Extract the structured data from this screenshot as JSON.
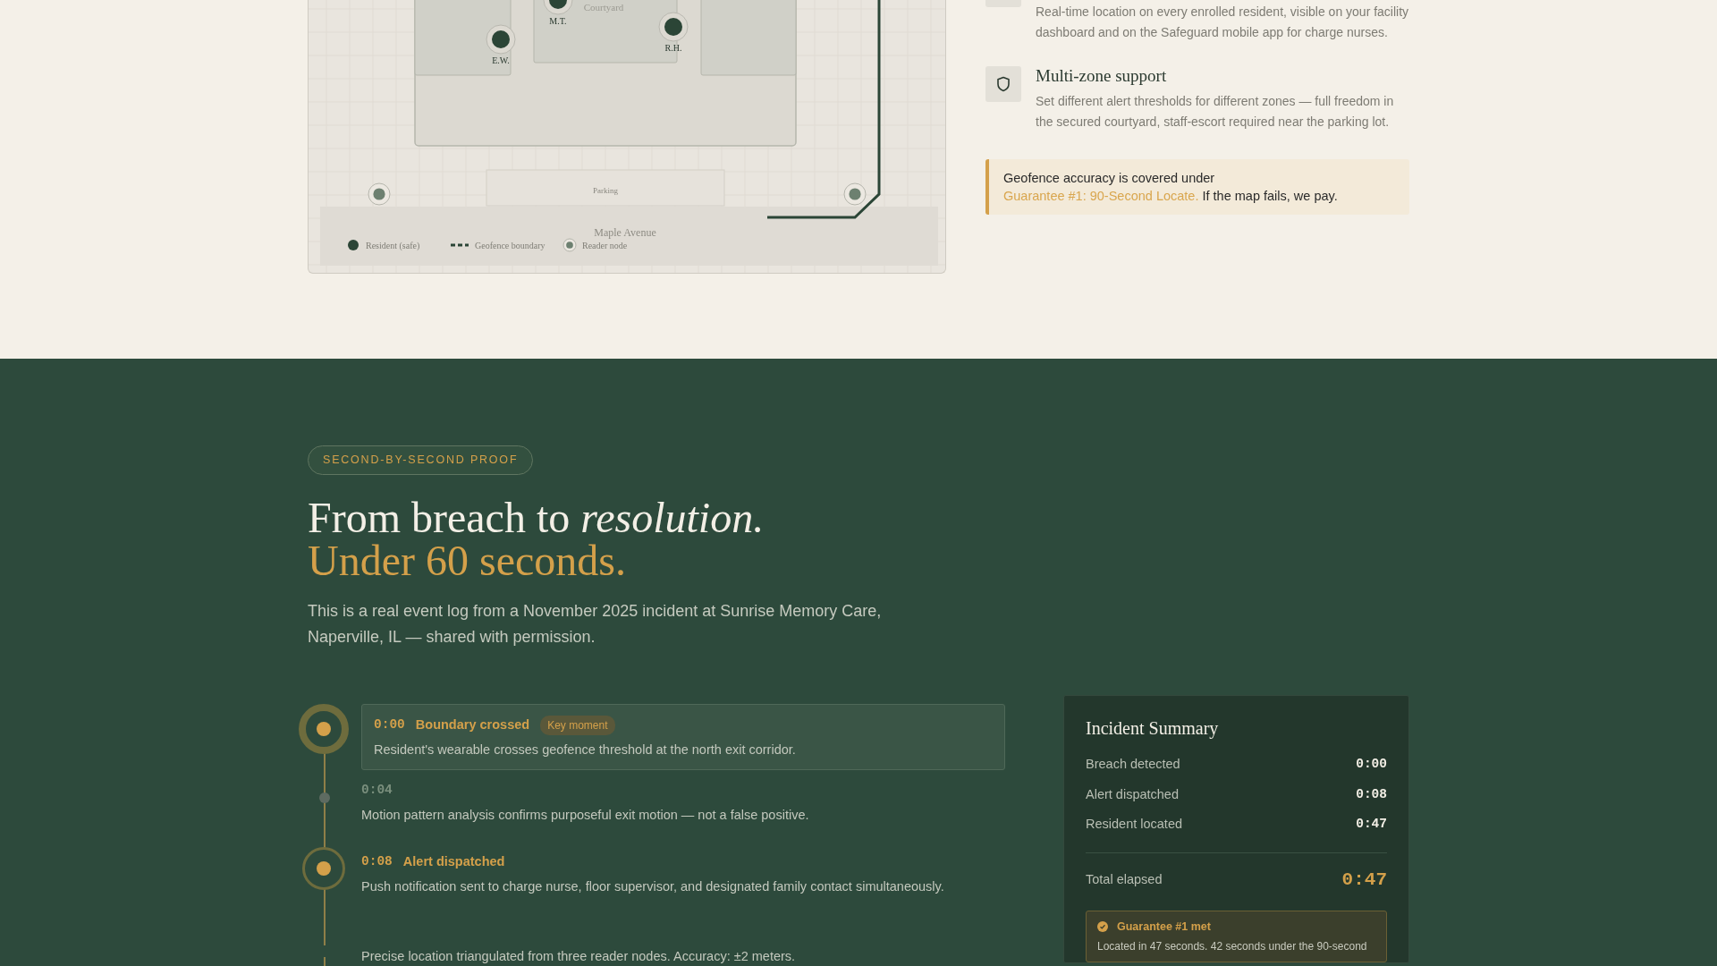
{
  "map": {
    "zone_label": "Courtyard",
    "parking_label": "Parking",
    "street_label": "Maple Avenue",
    "residents": [
      {
        "initials": "M.T."
      },
      {
        "initials": "E.W."
      },
      {
        "initials": "R.H."
      }
    ],
    "legend": [
      {
        "kind": "resident",
        "label": "Resident (safe)"
      },
      {
        "kind": "boundary",
        "label": "Geofence boundary"
      },
      {
        "kind": "reader",
        "label": "Reader node"
      }
    ]
  },
  "features": [
    {
      "description": "Real-time location on every enrolled resident, visible on your facility dashboard and on the Safeguard mobile app for charge nurses."
    },
    {
      "title": "Multi-zone support",
      "description": "Set different alert thresholds for different zones — full freedom in the secured courtyard, staff-escort required near the parking lot."
    }
  ],
  "callout": {
    "before": "Geofence accuracy is covered under",
    "link": "Guarantee #1: 90-Second Locate.",
    "after": "If the map fails, we pay."
  },
  "proof": {
    "badge": "SECOND-BY-SECOND PROOF",
    "heading": "From breach to *resolution.*",
    "subheading": "Under 60 seconds.",
    "intro": "This is a real event log from a November 2025 incident at Sunrise Memory Care, Naperville, IL — shared with permission."
  },
  "timeline": [
    {
      "kind": "card",
      "time": "0:00",
      "title": "Boundary crossed",
      "tag": "Key moment",
      "description": "Resident's wearable crosses geofence threshold at the north exit corridor."
    },
    {
      "kind": "muted",
      "time": "0:04",
      "description": "Motion pattern analysis confirms purposeful exit motion — not a false positive."
    },
    {
      "kind": "step",
      "time": "0:08",
      "title": "Alert dispatched",
      "description": "Push notification sent to charge nurse, floor supervisor, and designated family contact simultaneously."
    },
    {
      "kind": "plain",
      "description": "Precise location triangulated from three reader nodes. Accuracy: ±2 meters."
    }
  ],
  "summary": {
    "title": "Incident Summary",
    "rows": [
      {
        "label": "Breach detected",
        "value": "0:00"
      },
      {
        "label": "Alert dispatched",
        "value": "0:08"
      },
      {
        "label": "Resident located",
        "value": "0:47"
      }
    ],
    "total_label": "Total elapsed",
    "total_value": "0:47",
    "guarantee_title": "Guarantee #1 met",
    "guarantee_text": "Located in 47 seconds. 42 seconds under the 90-second"
  }
}
